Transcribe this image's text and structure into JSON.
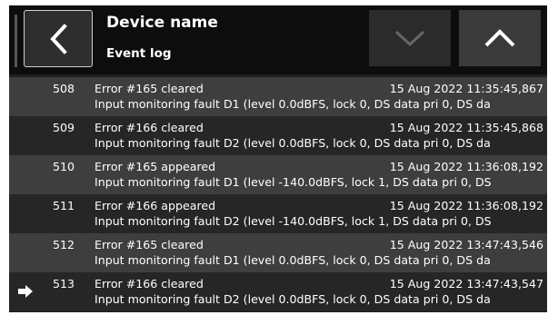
{
  "header": {
    "title": "Device name",
    "subtitle": "Event log",
    "back_icon": "chevron-left-icon",
    "down_icon": "chevron-down-icon",
    "up_icon": "chevron-up-icon"
  },
  "colors": {
    "header_bg": "#0d0d0d",
    "row_light": "#3e3e3e",
    "row_dark": "#262626",
    "text": "#ffffff"
  },
  "current_marker_icon": "arrow-right-icon",
  "log": [
    {
      "num": "508",
      "event": "Error #165 cleared",
      "time": "15 Aug 2022 11:35:45,867",
      "desc": "Input monitoring fault D1 (level 0.0dBFS, lock 0, DS data pri 0, DS da"
    },
    {
      "num": "509",
      "event": "Error #166 cleared",
      "time": "15 Aug 2022 11:35:45,868",
      "desc": "Input monitoring fault D2 (level 0.0dBFS, lock 0, DS data pri 0, DS da"
    },
    {
      "num": "510",
      "event": "Error #165 appeared",
      "time": "15 Aug 2022 11:36:08,192",
      "desc": "Input monitoring fault D1 (level -140.0dBFS, lock 1, DS data pri 0, DS"
    },
    {
      "num": "511",
      "event": "Error #166 appeared",
      "time": "15 Aug 2022 11:36:08,192",
      "desc": "Input monitoring fault D2 (level -140.0dBFS, lock 1, DS data pri 0, DS"
    },
    {
      "num": "512",
      "event": "Error #165 cleared",
      "time": "15 Aug 2022 13:47:43,546",
      "desc": "Input monitoring fault D1 (level 0.0dBFS, lock 0, DS data pri 0, DS da"
    },
    {
      "num": "513",
      "event": "Error #166 cleared",
      "time": "15 Aug 2022 13:47:43,547",
      "desc": "Input monitoring fault D2 (level 0.0dBFS, lock 0, DS data pri 0, DS da"
    }
  ]
}
